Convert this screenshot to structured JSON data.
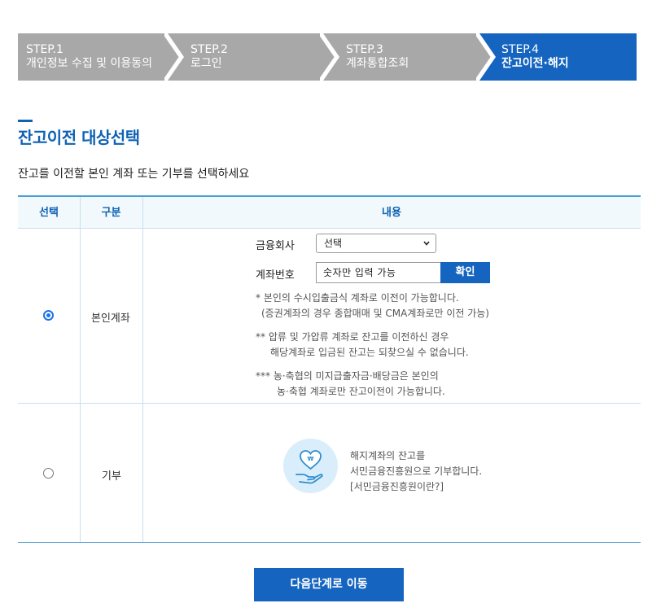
{
  "steps": [
    {
      "num": "STEP.1",
      "label": "개인정보 수집 및 이용동의",
      "active": false
    },
    {
      "num": "STEP.2",
      "label": "로그인",
      "active": false
    },
    {
      "num": "STEP.3",
      "label": "계좌통합조회",
      "active": false
    },
    {
      "num": "STEP.4",
      "label": "잔고이전·해지",
      "active": true
    }
  ],
  "colors": {
    "step_inactive": "#a8a8a8",
    "step_active": "#1565c0",
    "accent": "#0f62b4"
  },
  "page": {
    "title": "잔고이전 대상선택",
    "subtitle": "잔고를 이전할 본인 계좌 또는 기부를 선택하세요"
  },
  "table": {
    "headers": {
      "select": "선택",
      "category": "구분",
      "content": "내용"
    },
    "rows": [
      {
        "category": "본인계좌",
        "selected": true,
        "company_label": "금융회사",
        "company_value": "선택",
        "account_label": "계좌번호",
        "account_placeholder": "숫자만 입력 가능",
        "confirm_label": "확인",
        "notes": [
          {
            "line1": "* 본인의 수시입출금식 계좌로 이전이 가능합니다.",
            "line2": "(증권계좌의 경우 종합매매 및 CMA계좌로만 이전 가능)"
          },
          {
            "line1": "** 압류 및 가압류 계좌로 잔고를 이전하신 경우",
            "line2": "해당계좌로 입금된 잔고는 되찾으실 수 없습니다."
          },
          {
            "line1": "*** 농·축협의 미지급출자금·배당금은 본인의",
            "line2": "농·축협 계좌로만 잔고이전이 가능합니다."
          }
        ]
      },
      {
        "category": "기부",
        "selected": false,
        "icon": "donation-heart-hand-icon",
        "donate_line1": "해지계좌의 잔고를",
        "donate_line2": "서민금융진흥원으로 기부합니다.",
        "donate_link": "[서민금융진흥원이란?]"
      }
    ]
  },
  "next_button": "다음단계로 이동"
}
